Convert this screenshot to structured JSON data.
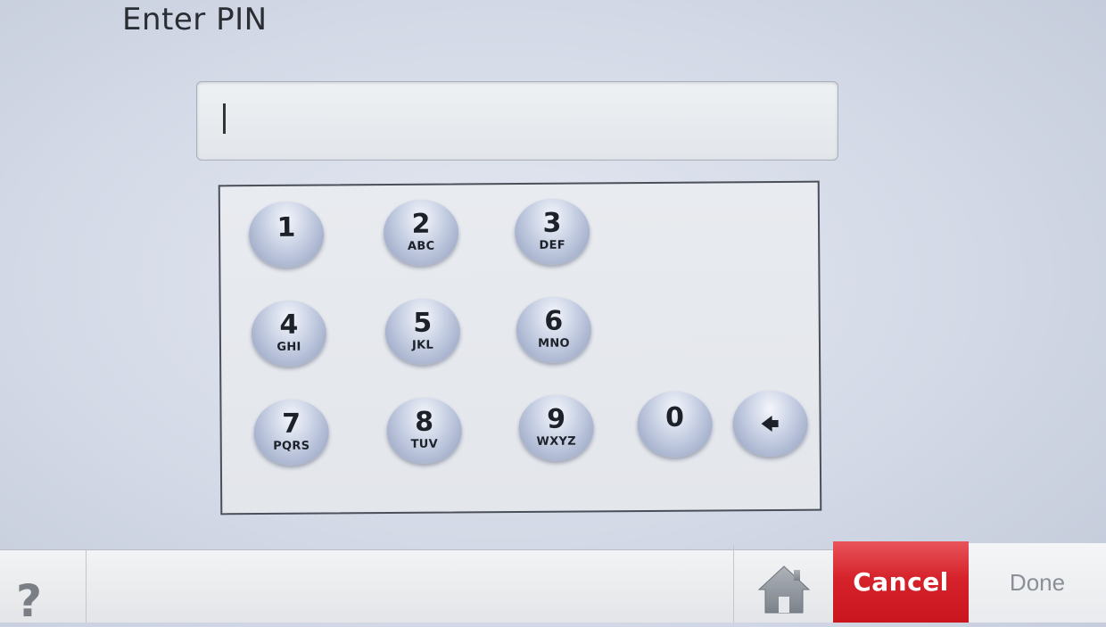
{
  "screen": {
    "title": "Enter PIN"
  },
  "pin_field": {
    "value": ""
  },
  "keypad": {
    "keys": [
      {
        "number": "1",
        "letters": ""
      },
      {
        "number": "2",
        "letters": "ABC"
      },
      {
        "number": "3",
        "letters": "DEF"
      },
      {
        "number": "4",
        "letters": "GHI"
      },
      {
        "number": "5",
        "letters": "JKL"
      },
      {
        "number": "6",
        "letters": "MNO"
      },
      {
        "number": "7",
        "letters": "PQRS"
      },
      {
        "number": "8",
        "letters": "TUV"
      },
      {
        "number": "9",
        "letters": "WXYZ"
      },
      {
        "number": "0",
        "letters": ""
      }
    ],
    "backspace_icon": "backspace-icon"
  },
  "bottom_bar": {
    "help_label": "?",
    "home_icon": "home-icon",
    "cancel_label": "Cancel",
    "done_label": "Done"
  },
  "colors": {
    "cancel": "#d6232b",
    "key": "#c5cee2"
  }
}
